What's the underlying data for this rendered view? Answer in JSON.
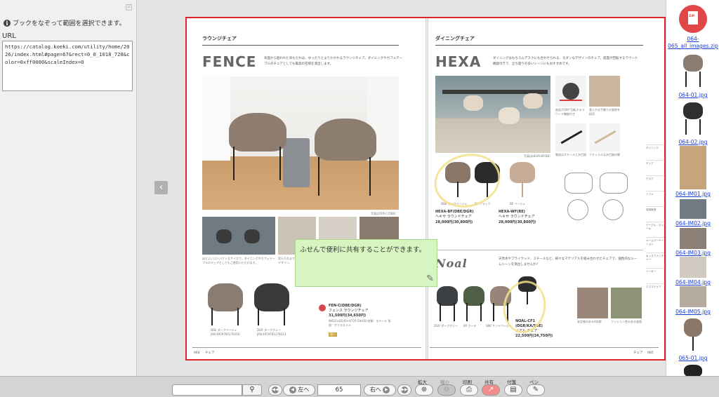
{
  "left_panel": {
    "hint": "ブックをなぞって範囲を選択できます。",
    "url_label": "URL",
    "url_value": "https://catalog.koeki.com/utility/home/2026/index.html#page=67&rect=0_0_1018_720&color=0xff0000&scaleIndex=0"
  },
  "left_page": {
    "section": "ラウンジチェア",
    "brand": "FENCE",
    "desc": "背面から囲われた背もたれは、ゆったりとよりかかれるラウンジチェア。ダイニングやカフェテーブルのチェアとしても最高の空間を演出します。",
    "photo_caption": "写真はFEN-C(DBE)",
    "small_caption_1": "ほどよいコンパクトなサイズで、ダイニングやカフェテーブルのチェアとしてもご使用いただけます。",
    "small_caption_2": "背もたれまで一体で包み込むデザイン。",
    "product_1_color": "DBE ダークベージュ",
    "product_1_code": "JAN 4959785176016",
    "product_2_color": "DGR ダークグレー",
    "product_2_code": "JAN 4959785176023",
    "model": "FEN-C(DBE/DGR)",
    "model_name": "フェンス ラウンジチェア",
    "price": "31,500円(34,650円)",
    "spec": "W610×D540×H720 SH430 材質：スチール 張地：ポリエステル",
    "stock_badge": "個人",
    "footer_page": "064",
    "footer_category": "チェア"
  },
  "right_page": {
    "section": "ダイニングチェア",
    "brand": "HEXA",
    "desc": "ダイニングはもちろんデスクにも合わせられる、モダンなデザインのチェア。座面が回転するラウンド機能付きで、立ち座りの多いシーンにもおすすめです。",
    "photo_caption": "写真はHEXA-BF(BE)",
    "detail_caption_1": "座面が360°回転するラウンド機能付き",
    "detail_caption_2": "柔らかな手触りの張地を採用",
    "detail_caption_3": "脚部はスチールと木目調",
    "detail_caption_4": "ナチュラルな木目調の脚",
    "colors": [
      "DBE ダークベージュ",
      "BK ブラック",
      "BE ベージュ"
    ],
    "model_1": "HEXA-BF(DBE/DGR)",
    "model_1_name": "ヘキサ ラウンドチェア",
    "price_1": "28,000円(30,800円)",
    "model_2": "HEXA-WF(BE)",
    "model_2_name": "ヘキサ ラウンドチェア",
    "price_2": "28,000円(30,800円)",
    "noal_brand": "Noal",
    "noal_desc": "天然木やプライウッド、スチールなど、様々なマテリアルを組み合わせたチェアで、個性的なルームシーンを演出しませんか?",
    "noal_colors": [
      "DGR ダークグレー",
      "KA カーキ",
      "SBE サンドベージュ"
    ],
    "noal_model": "NOAL-CF1",
    "noal_model_sub": "(DGR/KA/SBE)",
    "noal_name": "ノアル チェア",
    "noal_price": "22,500円(24,750円)",
    "noal_caption_1": "安定感のある4本脚",
    "noal_caption_2": "クッション性のある座面",
    "side_tabs": [
      "ダイニング",
      "チェア",
      "デスク",
      "ソファ",
      "収納家具",
      "テーブル・スツール",
      "ルームパーテーション",
      "キッズファニチャー",
      "ソーター",
      "エクステリア"
    ],
    "footer_category": "チェア",
    "footer_page": "065"
  },
  "sticky_note": {
    "text": "ふせんで便利に共有することができます。"
  },
  "thumbnails": [
    {
      "label": "064-065_all_images.zip"
    },
    {
      "label": "064-01.jpg"
    },
    {
      "label": "064-02.jpg"
    },
    {
      "label": "064-IM01.jpg"
    },
    {
      "label": "064-IM02.jpg"
    },
    {
      "label": "064-IM03.jpg"
    },
    {
      "label": "064-IM04.jpg"
    },
    {
      "label": "064-IM05.jpg"
    },
    {
      "label": "065-01.jpg"
    }
  ],
  "toolbar": {
    "search_placeholder": "",
    "first_label": "",
    "prev_label": "左へ",
    "page_value": "65",
    "next_label": "右へ",
    "labels": {
      "zoom_in": "拡大",
      "zoom_out": "縮小",
      "print": "印刷",
      "share": "共有",
      "sticky": "付箋",
      "pen": "ペン"
    }
  },
  "colors": {
    "accent_red": "#e0242c",
    "sticky_green": "#d6f5c0",
    "link_blue": "#1b3fd0",
    "annotation_yellow": "#f2e08a"
  }
}
